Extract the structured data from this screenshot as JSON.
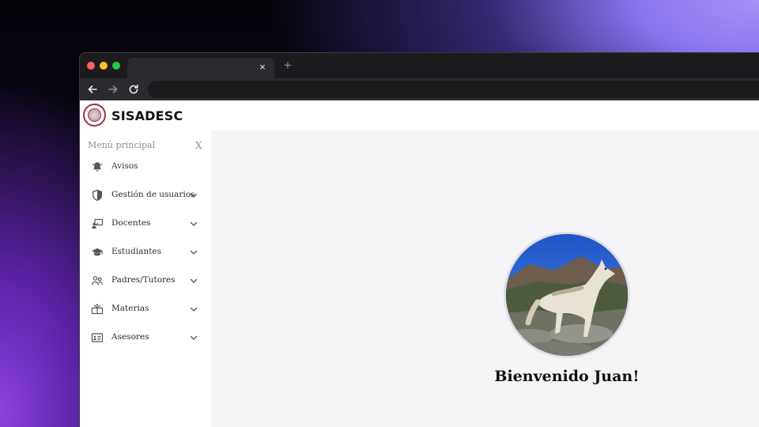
{
  "browser": {
    "tab_close_icon": "×",
    "new_tab_icon": "+",
    "back_icon": "arrow-left-icon",
    "forward_icon": "arrow-right-icon",
    "reload_icon": "reload-icon"
  },
  "app": {
    "brand": "SISADESC",
    "logo_icon": "school-seal-logo"
  },
  "sidebar": {
    "title": "Menú principal",
    "close_label": "X",
    "items": [
      {
        "label": "Avisos",
        "icon": "bell-icon",
        "has_submenu": false
      },
      {
        "label": "Gestión de usuarios",
        "icon": "shield-icon",
        "has_submenu": true
      },
      {
        "label": "Docentes",
        "icon": "teacher-icon",
        "has_submenu": true
      },
      {
        "label": "Estudiantes",
        "icon": "graduation-cap-icon",
        "has_submenu": true
      },
      {
        "label": "Padres/Tutores",
        "icon": "people-icon",
        "has_submenu": true
      },
      {
        "label": "Materias",
        "icon": "book-icon",
        "has_submenu": true
      },
      {
        "label": "Asesores",
        "icon": "id-card-icon",
        "has_submenu": true
      }
    ]
  },
  "main": {
    "avatar": "profile-photo-wolf",
    "welcome_text": "Bienvenido Juan!"
  },
  "colors": {
    "brand_accent": "#a0313f",
    "main_background": "#f5f5f8",
    "sidebar_background": "#ffffff"
  }
}
